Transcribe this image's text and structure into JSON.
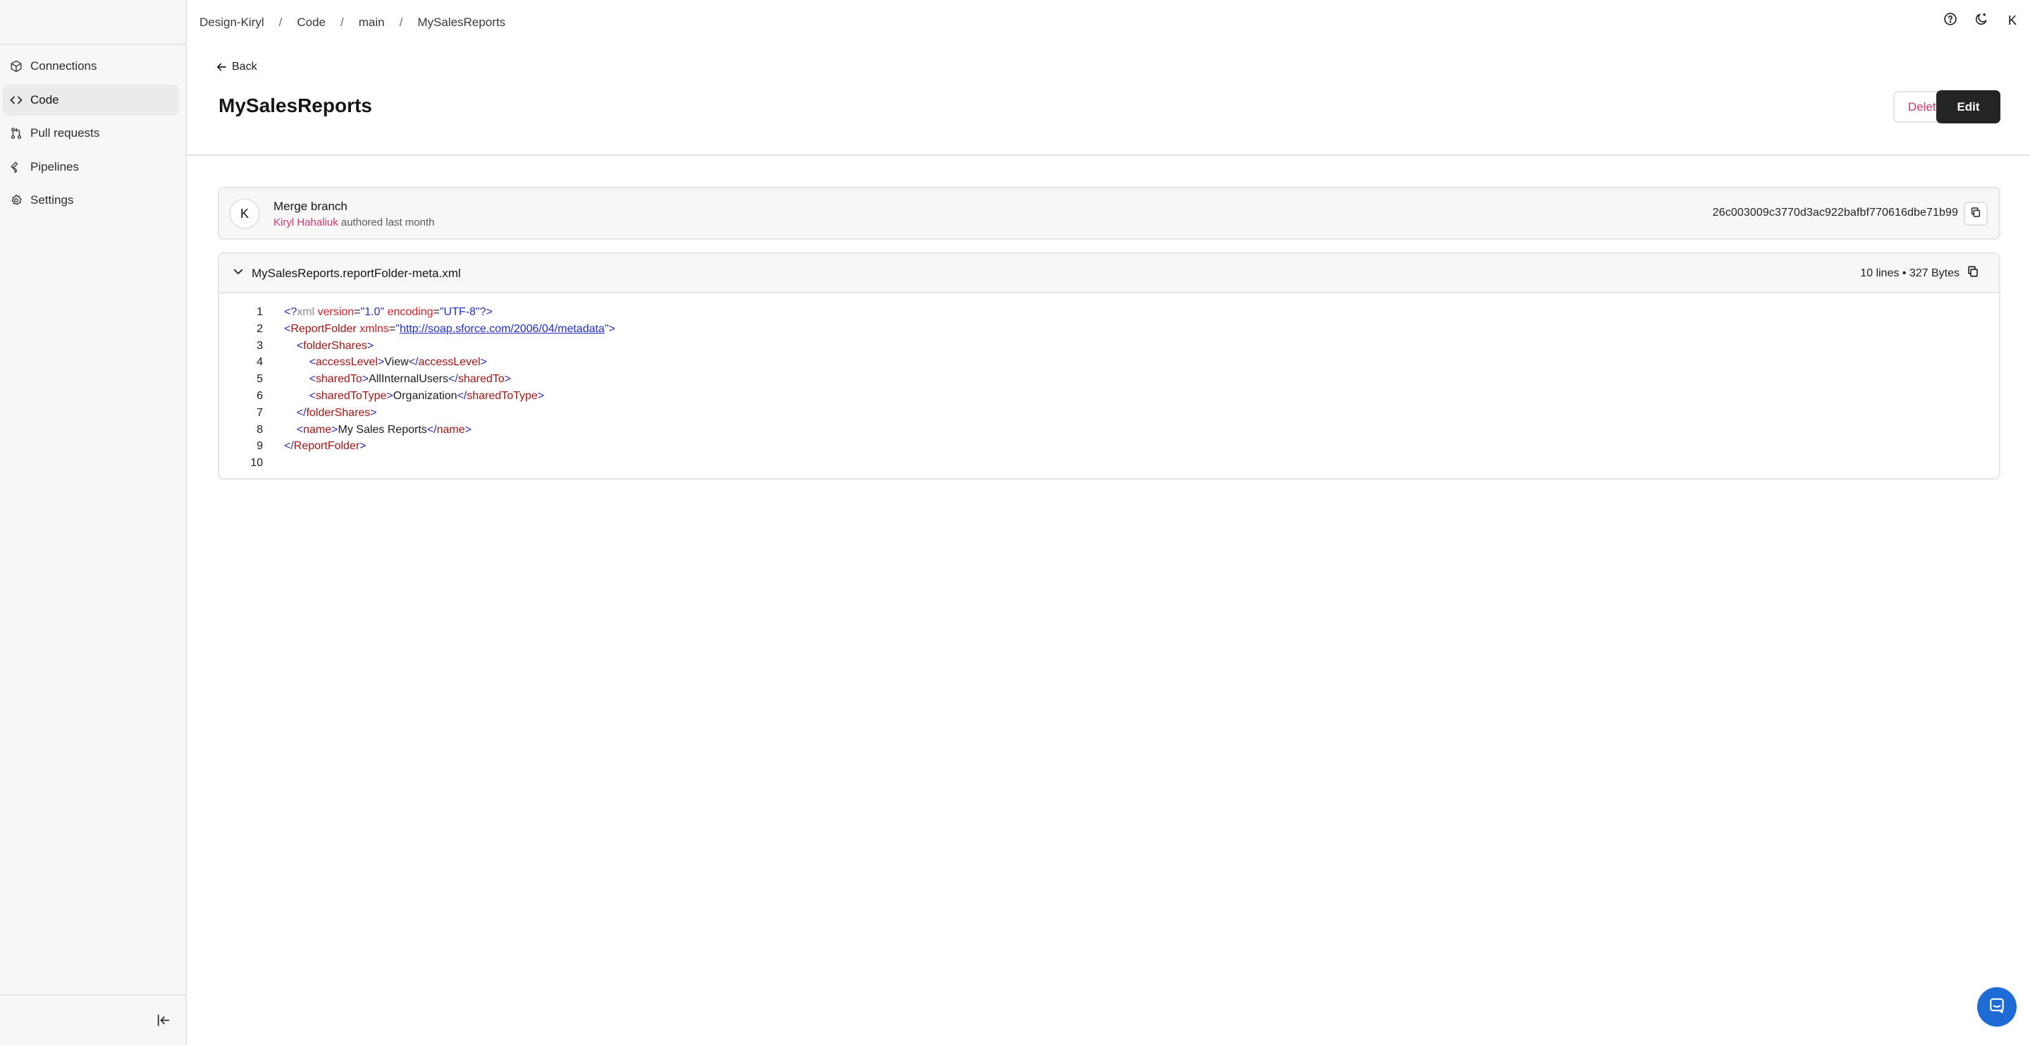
{
  "breadcrumb": [
    "Design-Kiryl",
    "Code",
    "main",
    "MySalesReports"
  ],
  "breadcrumb_separator": "/",
  "sidebar": {
    "items": [
      {
        "label": "Connections",
        "icon": "cube-icon",
        "active": false
      },
      {
        "label": "Code",
        "icon": "code-icon",
        "active": true
      },
      {
        "label": "Pull requests",
        "icon": "pull-request-icon",
        "active": false
      },
      {
        "label": "Pipelines",
        "icon": "wrench-icon",
        "active": false
      },
      {
        "label": "Settings",
        "icon": "gear-icon",
        "active": false
      }
    ],
    "collapse_icon": "collapse-sidebar-icon"
  },
  "topbar": {
    "help_icon": "help-icon",
    "theme_icon": "moon-icon",
    "avatar": "K"
  },
  "header": {
    "back_label": "Back",
    "title": "MySalesReports",
    "delete_label": "Delete",
    "edit_label": "Edit"
  },
  "commit": {
    "avatar": "K",
    "message": "Merge branch",
    "author": "Kiryl Hahaliuk",
    "meta": "authored last month",
    "hash": "26c003009c3770d3ac922bafbf770616dbe71b99"
  },
  "file": {
    "name": "MySalesReports.reportFolder-meta.xml",
    "stats": "10 lines • 327 Bytes",
    "line_numbers": [
      "1",
      "2",
      "3",
      "4",
      "5",
      "6",
      "7",
      "8",
      "9",
      "10"
    ]
  },
  "colors": {
    "accent_pink": "#d0386a",
    "button_dark": "#222426",
    "chat_blue": "#1f6bd6"
  }
}
